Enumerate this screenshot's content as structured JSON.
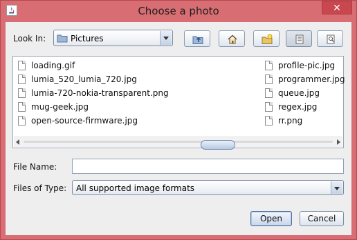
{
  "window": {
    "title": "Choose a photo",
    "close_symbol": "✕"
  },
  "look_in": {
    "label": "Look In:",
    "value": "Pictures"
  },
  "toolbar": {
    "buttons": [
      {
        "name": "up-one-level",
        "icon": "folder-up-icon"
      },
      {
        "name": "home",
        "icon": "home-icon"
      },
      {
        "name": "new-folder",
        "icon": "new-folder-icon"
      },
      {
        "name": "list-view",
        "icon": "list-view-icon",
        "selected": true
      },
      {
        "name": "details-view",
        "icon": "details-view-icon",
        "selected": false
      }
    ]
  },
  "files": {
    "column1": [
      "loading.gif",
      "lumia_520_lumia_720.jpg",
      "lumia-720-nokia-transparent.png",
      "mug-geek.jpg",
      "open-source-firmware.jpg"
    ],
    "column2": [
      "profile-pic.jpg",
      "programmer.jpg",
      "queue.jpg",
      "regex.jpg",
      "rr.png"
    ]
  },
  "file_name": {
    "label": "File Name:",
    "value": ""
  },
  "file_type": {
    "label": "Files of Type:",
    "value": "All supported image formats"
  },
  "actions": {
    "open_label": "Open",
    "cancel_label": "Cancel"
  },
  "colors": {
    "title_bar": "#d86d73",
    "close_button": "#c9474e",
    "dialog_body": "#eeeeee"
  }
}
